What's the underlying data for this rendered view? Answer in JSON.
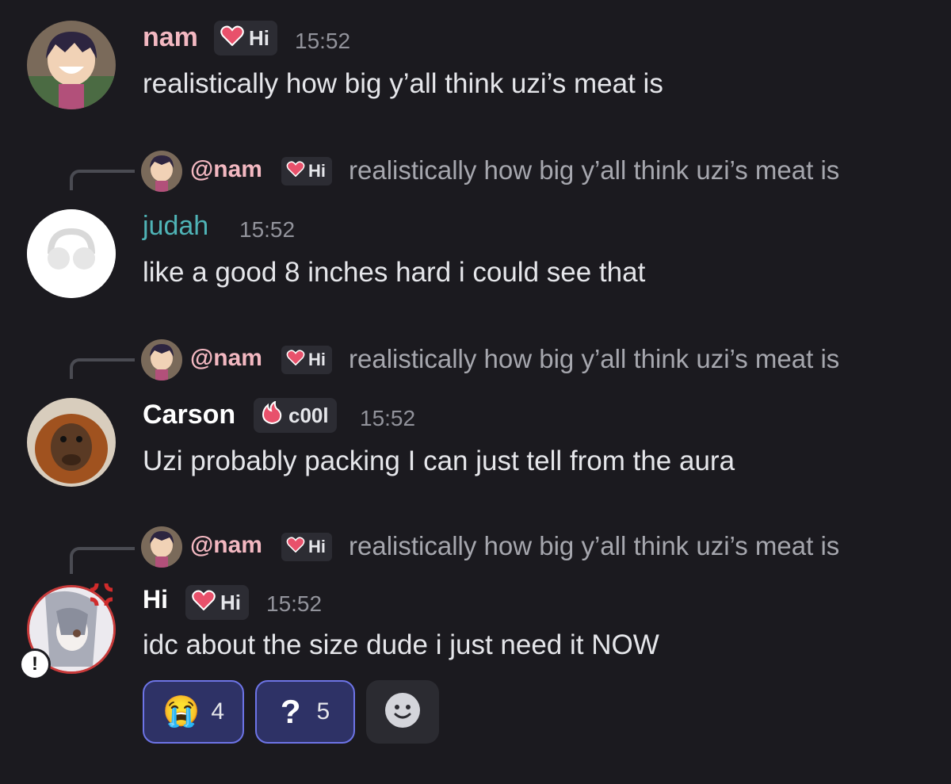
{
  "colors": {
    "background": "#1b1a1f",
    "nam_name": "#f3b8c1",
    "judah_name": "#4fb3b6",
    "reaction_border": "#6d74e6",
    "reaction_bg": "#2e3266"
  },
  "messages": [
    {
      "author": "nam",
      "tag": "Hi",
      "time": "15:52",
      "text": "realistically how big y’all think uzi’s meat is"
    },
    {
      "reply": {
        "author": "@nam",
        "tag": "Hi",
        "text": "realistically how big y’all think uzi’s meat is"
      },
      "author": "judah",
      "time": "15:52",
      "text": "like a good 8 inches hard i could see that"
    },
    {
      "reply": {
        "author": "@nam",
        "tag": "Hi",
        "text": "realistically how big y’all think uzi’s meat is"
      },
      "author": "Carson",
      "tag": "c00l",
      "time": "15:52",
      "text": "Uzi probably packing I can just tell from the aura"
    },
    {
      "reply": {
        "author": "@nam",
        "tag": "Hi",
        "text": "realistically how big y’all think uzi’s meat is"
      },
      "author": "Hi",
      "tag": "Hi",
      "time": "15:52",
      "text": "idc about the size dude i just need it NOW"
    }
  ],
  "reactions": [
    {
      "emoji": "😭",
      "count": "4"
    },
    {
      "emoji": "?",
      "count": "5"
    }
  ],
  "icons": [
    "heart-icon",
    "fire-icon",
    "add-reaction-icon",
    "alert-icon"
  ]
}
